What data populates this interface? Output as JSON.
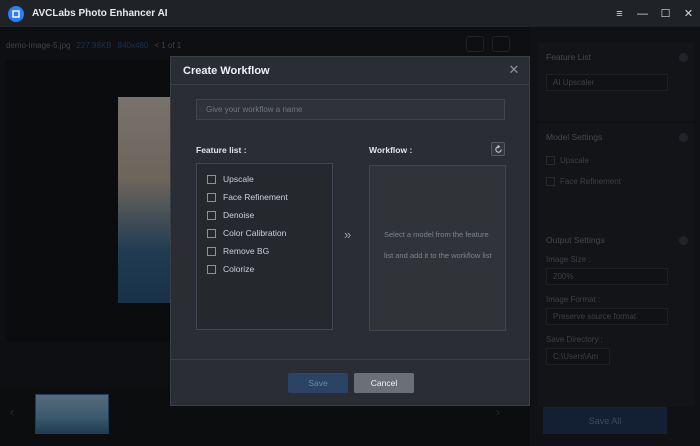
{
  "window": {
    "title": "AVCLabs Photo Enhancer AI",
    "controls": [
      "≡",
      "—",
      "☐",
      "✕"
    ]
  },
  "mainbar": {
    "filename": "demo-image-5.jpg",
    "filesize": "227.98KB",
    "dimensions": "840x480",
    "page": "< 1 of 1"
  },
  "right_panel": {
    "feature_list_title": "Feature List",
    "feature_select": "AI Upscaler",
    "model_settings_title": "Model Settings",
    "model_items": [
      "Upscale",
      "Face Refinement"
    ],
    "output_settings_title": "Output Settings",
    "image_size_label": "Image Size :",
    "image_size_value": "200%",
    "image_format_label": "Image Format :",
    "image_format_value": "Preserve source format",
    "save_directory_label": "Save Directory :",
    "save_directory_value": "C:\\Users\\Am",
    "save_all": "Save All"
  },
  "dialog": {
    "title": "Create Workflow",
    "name_placeholder": "Give your workflow a name",
    "feature_list_label": "Feature list :",
    "workflow_label": "Workflow :",
    "features": [
      "Upscale",
      "Face Refinement",
      "Denoise",
      "Color Calibration",
      "Remove BG",
      "Colorize"
    ],
    "workflow_hint": "Select a model from the feature list and add it to the workflow list",
    "save_button": "Save",
    "cancel_button": "Cancel"
  },
  "colors": {
    "accent": "#2f7df6",
    "dialog_bg": "#2a2d33",
    "save_disabled": "#2b4466",
    "cancel_bg": "#6b6f78"
  }
}
